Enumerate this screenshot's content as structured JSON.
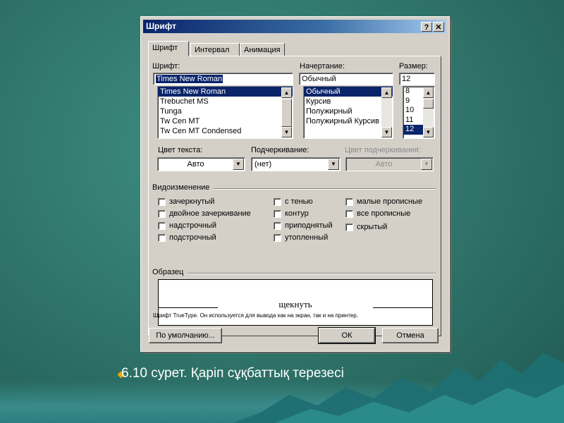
{
  "dialog": {
    "title": "Шрифт",
    "help_glyph": "?",
    "close_glyph": "✕",
    "tabs": [
      {
        "label": "Шрифт",
        "active": true
      },
      {
        "label": "Интервал",
        "active": false
      },
      {
        "label": "Анимация",
        "active": false
      }
    ],
    "font": {
      "label": "Шрифт:",
      "value": "Times New Roman",
      "items": [
        "Times New Roman",
        "Trebuchet MS",
        "Tunga",
        "Tw Cen MT",
        "Tw Cen MT Condensed"
      ],
      "selected_index": 0
    },
    "style": {
      "label": "Начертание:",
      "value": "Обычный",
      "items": [
        "Обычный",
        "Курсив",
        "Полужирный",
        "Полужирный Курсив"
      ],
      "selected_index": 0
    },
    "size": {
      "label": "Размер:",
      "value": "12",
      "items": [
        "8",
        "9",
        "10",
        "11",
        "12"
      ],
      "selected_index": 4
    },
    "text_color": {
      "label": "Цвет текста:",
      "value": "Авто"
    },
    "underline": {
      "label": "Подчеркивание:",
      "value": "(нет)"
    },
    "underline_color": {
      "label": "Цвет подчеркивания:",
      "value": "Авто",
      "disabled": true
    },
    "effects": {
      "label": "Видоизменение",
      "col1": [
        "зачеркнутый",
        "двойное зачеркивание",
        "надстрочный",
        "подстрочный"
      ],
      "col2": [
        "с тенью",
        "контур",
        "приподнятый",
        "утопленный"
      ],
      "col3": [
        "малые прописные",
        "все прописные",
        "скрытый"
      ]
    },
    "preview": {
      "label": "Образец",
      "sample": "щекнуть",
      "note": "Шрифт TrueType. Он используется для вывода как на экран, так и на принтер."
    },
    "buttons": {
      "default": "По умолчанию...",
      "ok": "ОК",
      "cancel": "Отмена"
    }
  },
  "caption": "6.10 сурет. Қаріп сұқбаттық терезесі",
  "colors": {
    "background": "#2e7268",
    "title_bar": "#0a246a",
    "bullet": "#f0a800",
    "dialog_face": "#d4d0c8"
  }
}
